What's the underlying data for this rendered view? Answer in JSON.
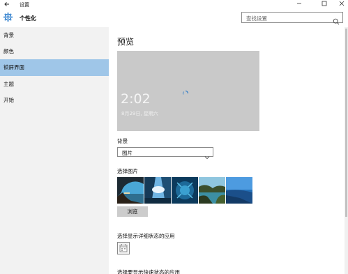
{
  "window": {
    "title": "设置"
  },
  "header": {
    "section_title": "个性化",
    "search_placeholder": "查找设置"
  },
  "sidebar": {
    "items": [
      {
        "label": "背景",
        "active": false
      },
      {
        "label": "颜色",
        "active": false
      },
      {
        "label": "锁屏界面",
        "active": true
      },
      {
        "label": "主题",
        "active": false
      },
      {
        "label": "开始",
        "active": false
      }
    ]
  },
  "main": {
    "title": "预览",
    "preview": {
      "time": "2:02",
      "date": "8月29日, 星期六"
    },
    "background_label": "背景",
    "background_value": "图片",
    "choose_picture_label": "选择图片",
    "pictures": [
      "beach-cave",
      "sky-window",
      "underwater",
      "lake-rocks",
      "sea-horizon"
    ],
    "browse_label": "浏览",
    "detailed_status_label": "选择显示详细状态的应用",
    "quick_status_label": "选择要显示快速状态的应用"
  },
  "colors": {
    "accent_selected": "#9fc6e8",
    "sidebar_bg": "#f2f2f2",
    "preview_bg": "#c9c9c9"
  }
}
